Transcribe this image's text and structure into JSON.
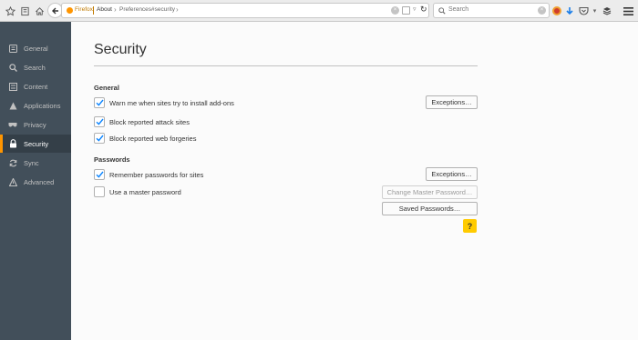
{
  "toolbar": {
    "url_identity": "Firefox",
    "url_page": "About",
    "url_path": "Preferences#security",
    "search_placeholder": "Search"
  },
  "sidebar": {
    "items": [
      {
        "label": "General",
        "icon": "general-icon"
      },
      {
        "label": "Search",
        "icon": "search-icon"
      },
      {
        "label": "Content",
        "icon": "content-icon"
      },
      {
        "label": "Applications",
        "icon": "applications-icon"
      },
      {
        "label": "Privacy",
        "icon": "privacy-mask-icon"
      },
      {
        "label": "Security",
        "icon": "lock-icon",
        "active": true
      },
      {
        "label": "Sync",
        "icon": "sync-icon"
      },
      {
        "label": "Advanced",
        "icon": "advanced-icon"
      }
    ]
  },
  "main": {
    "title": "Security",
    "general": {
      "heading": "General",
      "warn_addons": "Warn me when sites try to install add-ons",
      "block_attack": "Block reported attack sites",
      "block_forgeries": "Block reported web forgeries",
      "exceptions": "Exceptions…"
    },
    "passwords": {
      "heading": "Passwords",
      "remember": "Remember passwords for sites",
      "master": "Use a master password",
      "exceptions": "Exceptions…",
      "change_master": "Change Master Password…",
      "saved": "Saved Passwords…"
    },
    "help": "?"
  },
  "colors": {
    "accent": "#ff9500",
    "check": "#0a84ff",
    "sidebar_bg": "#424f5a",
    "help_bg": "#ffcb00"
  }
}
